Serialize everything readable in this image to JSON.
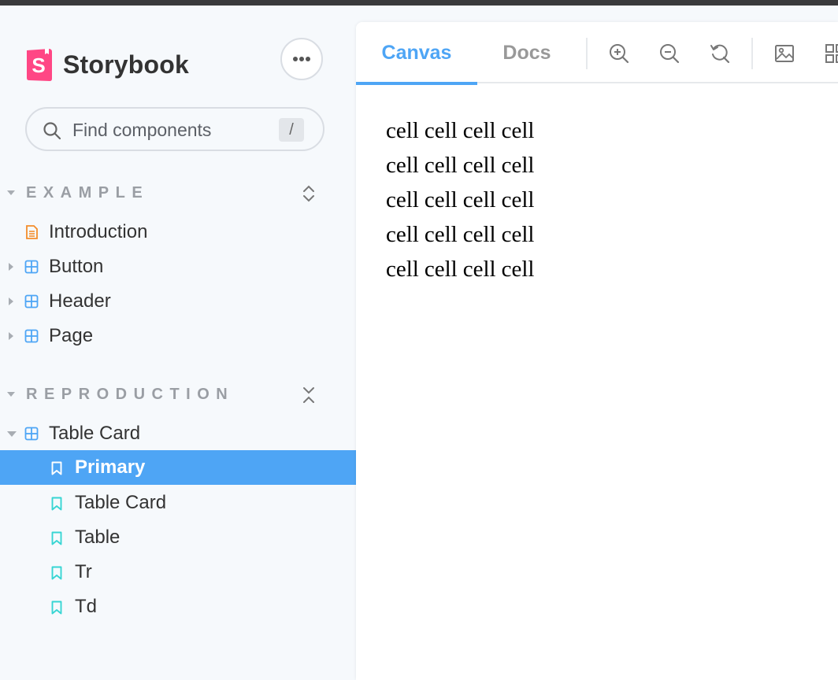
{
  "app": {
    "brand": "Storybook"
  },
  "colors": {
    "accent": "#4ea5f5",
    "logo": "#ff4785",
    "doc_icon": "#f38d2b",
    "component_icon": "#4ea5f5",
    "story_icon": "#37d5d3"
  },
  "sidebar": {
    "menu_icon": "ellipsis-icon",
    "search": {
      "placeholder": "Find components",
      "shortcut": "/"
    },
    "sections": [
      {
        "title": "EXAMPLE",
        "items": [
          {
            "label": "Introduction",
            "icon": "document-icon"
          },
          {
            "label": "Button",
            "icon": "component-icon"
          },
          {
            "label": "Header",
            "icon": "component-icon"
          },
          {
            "label": "Page",
            "icon": "component-icon"
          }
        ]
      },
      {
        "title": "REPRODUCTION",
        "items": [
          {
            "label": "Table Card",
            "icon": "component-icon",
            "expanded": true
          },
          {
            "label": "Primary",
            "icon": "bookmark-icon",
            "selected": true
          },
          {
            "label": "Table Card",
            "icon": "bookmark-icon"
          },
          {
            "label": "Table",
            "icon": "bookmark-icon"
          },
          {
            "label": "Tr",
            "icon": "bookmark-icon"
          },
          {
            "label": "Td",
            "icon": "bookmark-icon"
          }
        ]
      }
    ]
  },
  "toolbar": {
    "tabs": [
      {
        "label": "Canvas",
        "active": true
      },
      {
        "label": "Docs",
        "active": false
      }
    ],
    "tools": [
      "zoom-in-icon",
      "zoom-out-icon",
      "zoom-reset-icon",
      "background-icon",
      "grid-icon"
    ]
  },
  "canvas": {
    "rows": [
      [
        "cell",
        "cell",
        "cell",
        "cell"
      ],
      [
        "cell",
        "cell",
        "cell",
        "cell"
      ],
      [
        "cell",
        "cell",
        "cell",
        "cell"
      ],
      [
        "cell",
        "cell",
        "cell",
        "cell"
      ],
      [
        "cell",
        "cell",
        "cell",
        "cell"
      ]
    ]
  }
}
